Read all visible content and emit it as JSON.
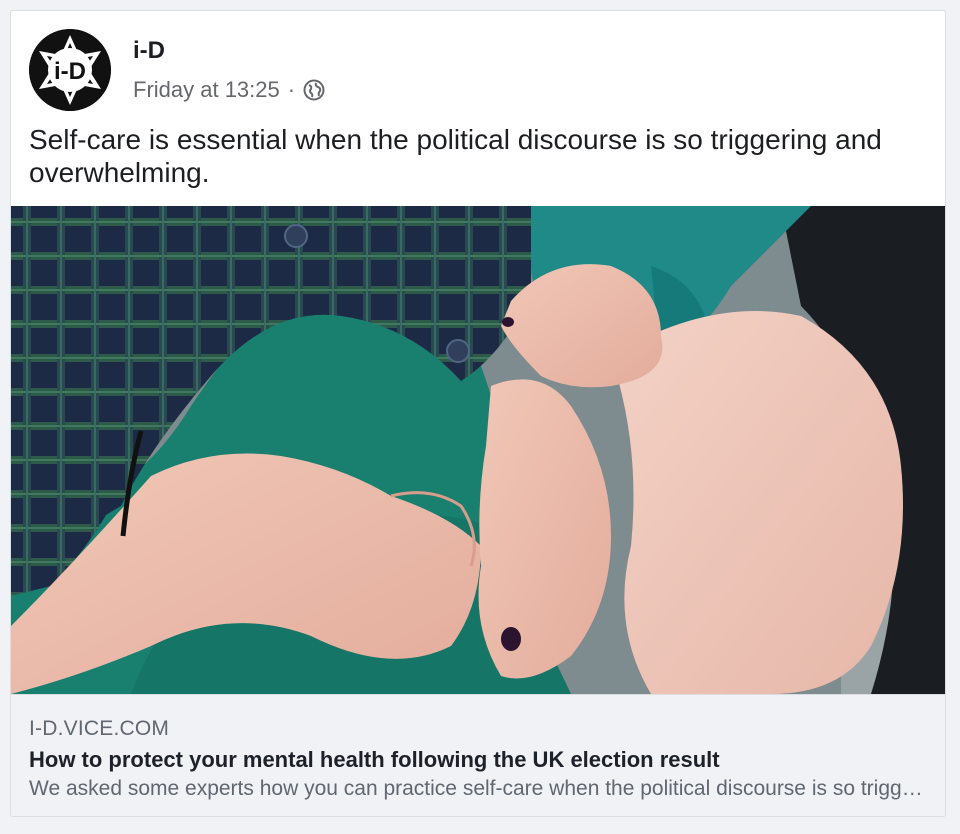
{
  "post": {
    "page_name": "i-D",
    "logo_text": "i-D",
    "timestamp": "Friday at 13:25",
    "separator": "·",
    "privacy_icon": "globe-icon",
    "text": "Self-care is essential when the political discourse is so triggering and overwhelming."
  },
  "link_preview": {
    "domain": "I-D.VICE.COM",
    "title": "How to protect your mental health following the UK election result",
    "description": "We asked some experts how you can practice self-care when the political discourse is so triggering and overwhelming."
  },
  "colors": {
    "background": "#f0f2f5",
    "card": "#ffffff",
    "secondary_text": "#65676b",
    "link_box": "#f0f2f5"
  }
}
